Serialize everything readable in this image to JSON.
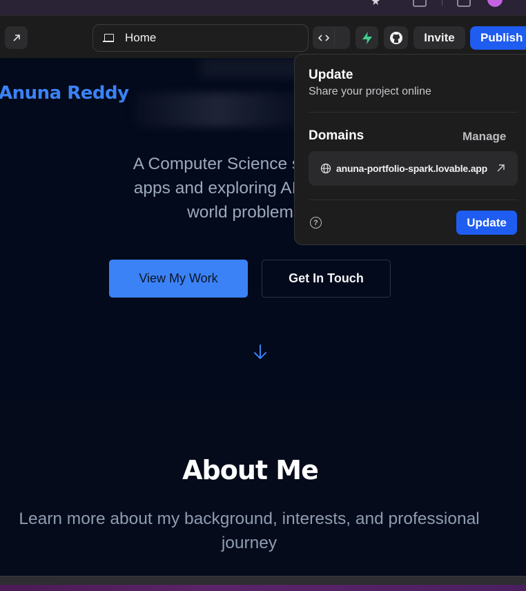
{
  "toolbar": {
    "address_label": "Home",
    "invite_label": "Invite",
    "publish_label": "Publish",
    "icons": [
      "expand-icon",
      "laptop-icon",
      "code-icon",
      "supabase-icon",
      "github-icon"
    ]
  },
  "site": {
    "brand": "Anuna Reddy",
    "hero_lines": [
      "A Computer Science student who l",
      "apps and exploring AI. I'm passion",
      "world problems usin"
    ],
    "primary_button": "View My Work",
    "secondary_button": "Get In Touch",
    "about_title": "About Me",
    "about_subtitle_lines": [
      "Learn more about my background, interests, and professional",
      "journey"
    ]
  },
  "popover": {
    "title": "Update",
    "subtitle": "Share your project online",
    "domains_label": "Domains",
    "manage_label": "Manage",
    "domain_url": "anuna-portfolio-spark.lovable.app",
    "help_glyph": "?",
    "update_button": "Update"
  },
  "colors": {
    "accent": "#1f5cf0",
    "brand_blue": "#3b82f6",
    "site_bg": "#030a1b",
    "panel_bg": "#1d1d1e"
  }
}
